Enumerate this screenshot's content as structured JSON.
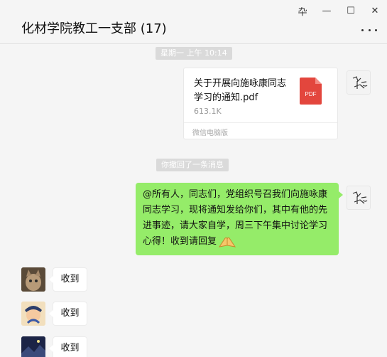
{
  "window": {
    "pin_label": "卆",
    "minimize_label": "—",
    "maximize_label": "☐",
    "close_label": "✕"
  },
  "header": {
    "title": "化材学院教工一支部 (17)"
  },
  "chat": {
    "timestamp": "星期一 上午 10:14",
    "file_message": {
      "file_name": "关于开展向施咏康同志学习的通知.pdf",
      "file_size": "613.1K",
      "file_type_label": "PDF",
      "source": "微信电脑版"
    },
    "recall_notice": "你撤回了一条消息",
    "announcement": "@所有人，同志们，党组织号召我们向施咏康同志学习，现将通知发给你们，其中有他的先进事迹，请大家自学，周三下午集中讨论学习心得！收到请回复",
    "replies": [
      {
        "text": "收到",
        "avatar": "cat-avatar"
      },
      {
        "text": "收到",
        "avatar": "portrait-avatar"
      },
      {
        "text": "收到",
        "avatar": "night-avatar"
      }
    ]
  },
  "colors": {
    "self_bubble": "#95ec69",
    "pdf_red": "#e3463d",
    "background": "#f5f5f5"
  }
}
